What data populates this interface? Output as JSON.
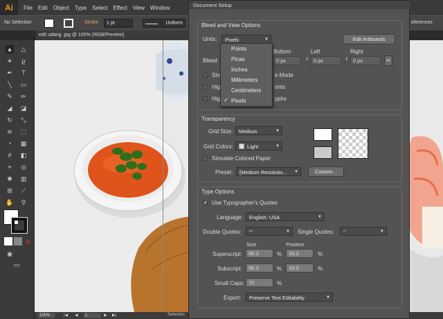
{
  "menubar": {
    "logo": "Ai",
    "items": [
      "File",
      "Edit",
      "Object",
      "Type",
      "Select",
      "Effect",
      "View",
      "Window"
    ]
  },
  "controlbar": {
    "selection": "No Selection",
    "stroke_label": "Stroke",
    "stroke_value": "1 pt",
    "profile": "Uniform",
    "right_text": "eferences"
  },
  "document": {
    "tab_title": "edit udang .jpg @ 100% (RGB/Preview)",
    "zoom": "100%",
    "page": "1",
    "status": "Selection"
  },
  "dialog": {
    "title": "Document Setup",
    "bleed_section": {
      "title": "Bleed and View Options",
      "units_label": "Units:",
      "units_value": "Pixels",
      "edit_artboards": "Edit Artboards",
      "bleed_label": "Bleed:",
      "bottom_label": "Bottom",
      "left_label": "Left",
      "right_label": "Right",
      "bottom_value": "0 px",
      "left_value": "0 px",
      "right_value": "0 px",
      "show_partial": "Sho",
      "show_partial_end": "e Mode",
      "high1": "High",
      "high1_end": "onts",
      "high2": "High",
      "high2_end": "yphs"
    },
    "units_dropdown": {
      "options": [
        "Points",
        "Picas",
        "Inches",
        "Millimeters",
        "Centimeters",
        "Pixels"
      ],
      "selected_index": 5
    },
    "transparency": {
      "title": "Transparency",
      "grid_size_label": "Grid Size:",
      "grid_size_value": "Medium",
      "grid_colors_label": "Grid Colors:",
      "grid_colors_value": "Light",
      "simulate_paper": "Simulate Colored Paper",
      "preset_label": "Preset:",
      "preset_value": "[Medium Resolutio...",
      "custom_button": "Custom..."
    },
    "type_options": {
      "title": "Type Options",
      "use_typographers_quotes": "Use Typographer's Quotes",
      "typographers_checked": true,
      "language_label": "Language:",
      "language_value": "English: USA",
      "double_quotes_label": "Double Quotes:",
      "double_quotes_value": "“”",
      "single_quotes_label": "Single Quotes:",
      "single_quotes_value": "‘’",
      "size_header": "Size",
      "position_header": "Position",
      "superscript_label": "Superscript:",
      "superscript_size": "58.3",
      "superscript_position": "33.3",
      "subscript_label": "Subscript:",
      "subscript_size": "58.3",
      "subscript_position": "33.3",
      "small_caps_label": "Small Caps:",
      "small_caps_value": "70",
      "percent": "%",
      "export_label": "Export:",
      "export_value": "Preserve Text Editability"
    }
  },
  "colors": {
    "app_bg": "#535353",
    "dialog_bg": "#535353",
    "menu_bg": "#3a3a3a",
    "logo_accent": "#f29421",
    "sauce": "#e0531a",
    "wood": "#b8742c"
  }
}
